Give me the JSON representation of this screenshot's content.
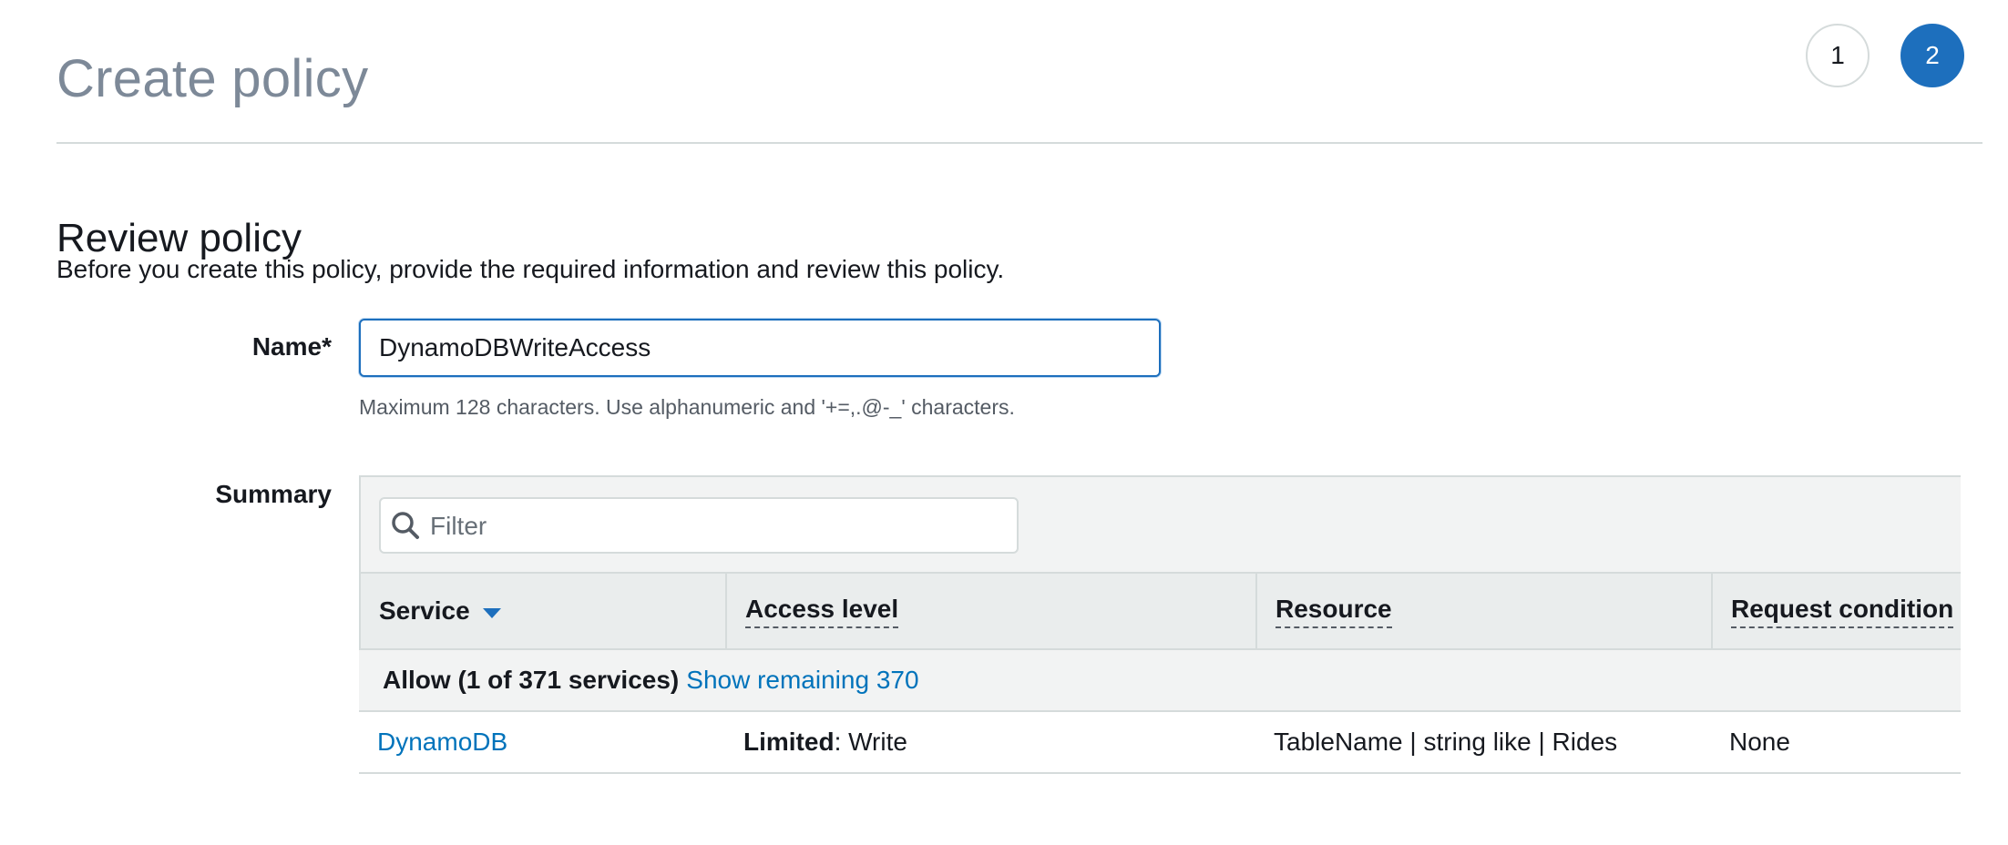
{
  "header": {
    "title": "Create policy",
    "steps": [
      "1",
      "2"
    ],
    "active_step": "2"
  },
  "review": {
    "title": "Review policy",
    "description": "Before you create this policy, provide the required information and review this policy."
  },
  "name_field": {
    "label": "Name*",
    "value": "DynamoDBWriteAccess",
    "hint": "Maximum 128 characters. Use alphanumeric and '+=,.@-_' characters."
  },
  "summary": {
    "label": "Summary",
    "filter_placeholder": "Filter",
    "columns": [
      "Service",
      "Access level",
      "Resource",
      "Request condition"
    ],
    "group": {
      "label": "Allow (1 of 371 services)",
      "link": "Show remaining 370"
    },
    "rows": [
      {
        "service": "DynamoDB",
        "access_level_strong": "Limited",
        "access_level_rest": ": Write",
        "resource": "TableName | string like | Rides",
        "condition": "None"
      }
    ]
  },
  "colors": {
    "accent": "#1d6fbd",
    "link": "#0073bb",
    "title_gray": "#7d8998"
  },
  "icons": {
    "filter": "search-icon",
    "sort": "caret-down-icon"
  }
}
